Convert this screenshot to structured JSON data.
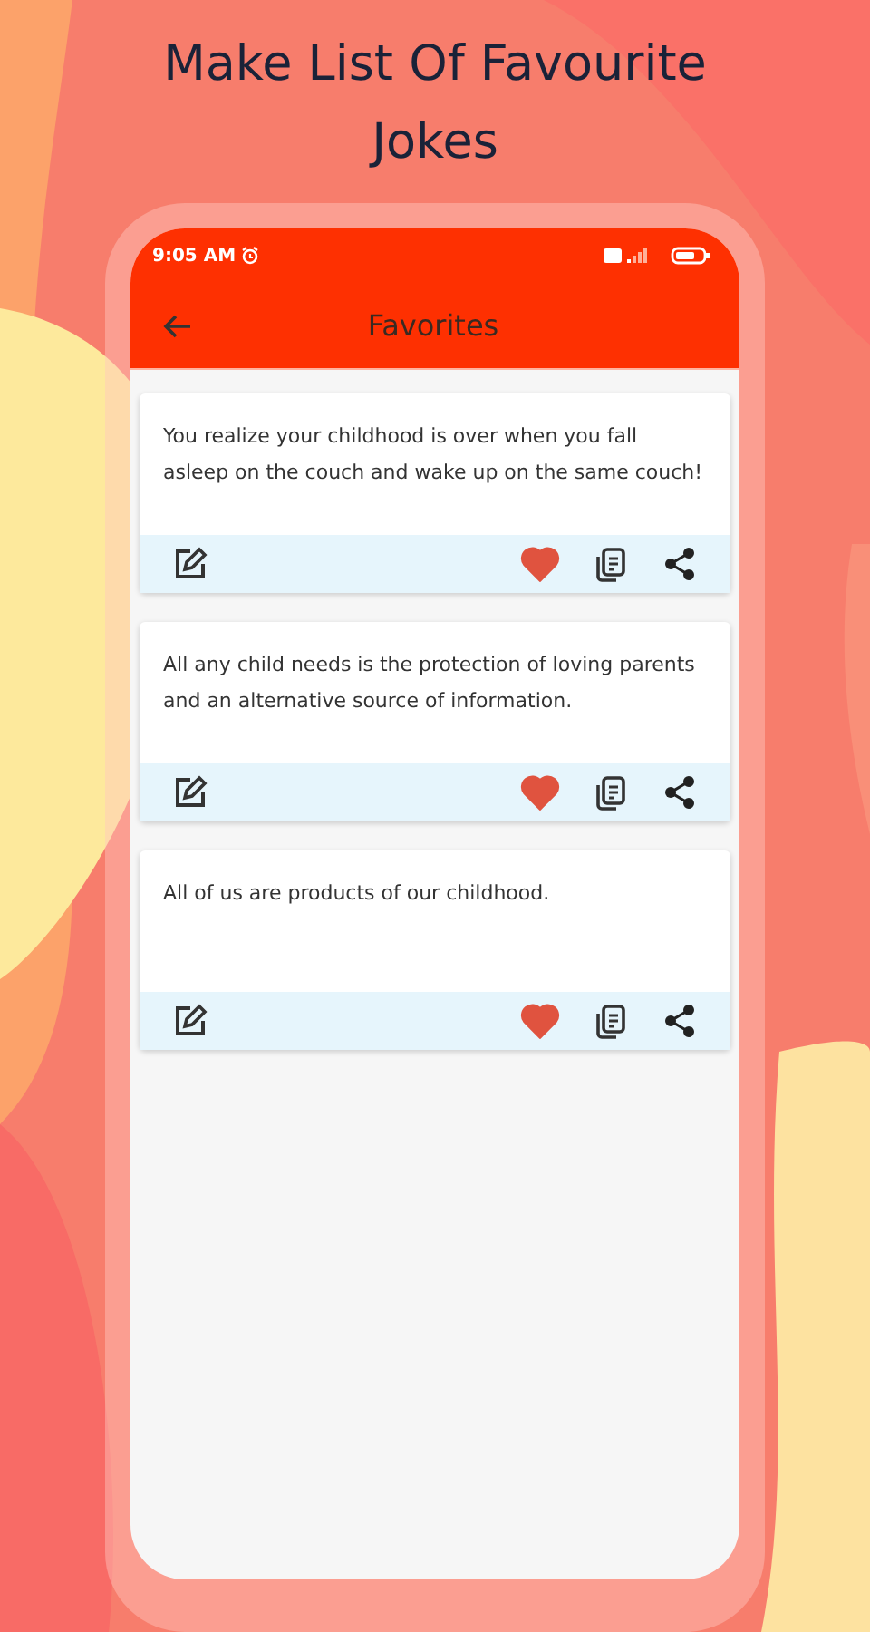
{
  "headline": "Make List Of Favourite Jokes",
  "status_bar": {
    "time": "9:05 AM"
  },
  "app_bar": {
    "title": "Favorites"
  },
  "jokes": [
    {
      "text": "You realize your childhood is over when you fall asleep on the couch and wake up on the same couch!",
      "favorite": true
    },
    {
      "text": "All any child needs is the protection of loving parents and an alternative source of information.",
      "favorite": true
    },
    {
      "text": "All of us are products of our childhood.",
      "favorite": true
    }
  ]
}
